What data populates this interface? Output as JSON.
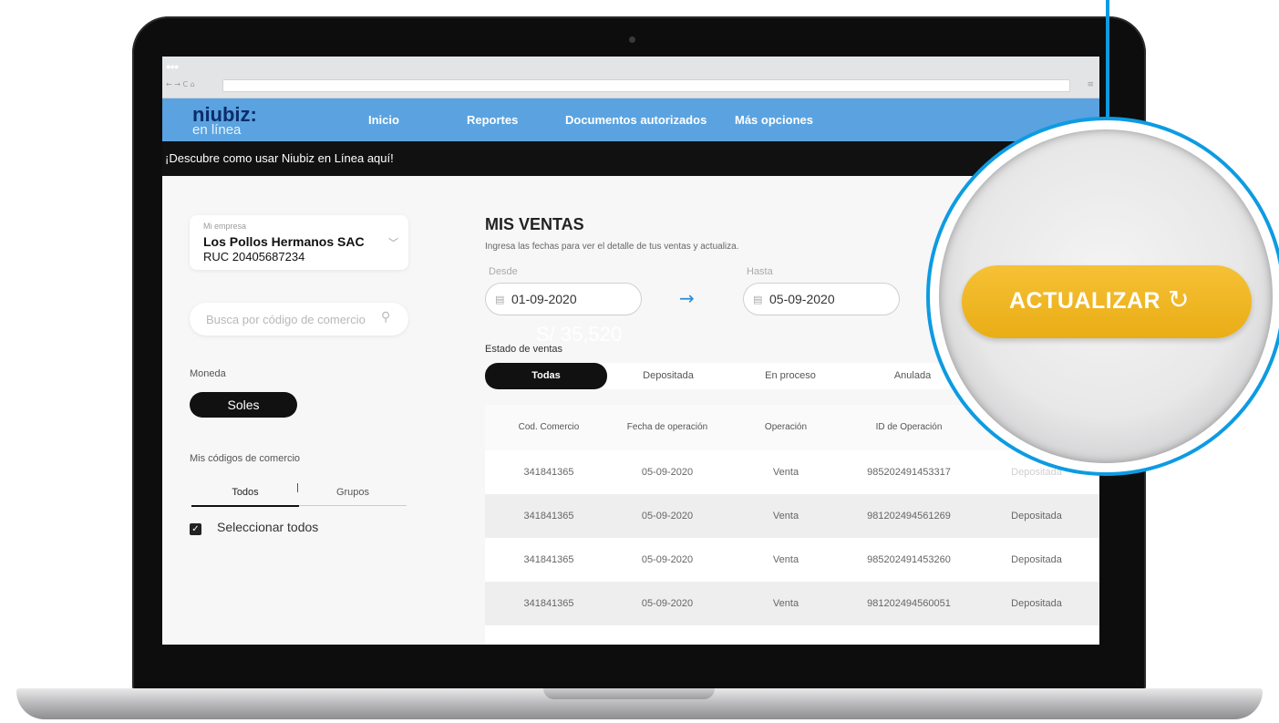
{
  "browser": {
    "dots": "●●●",
    "nav_icons": "← → C ⌂",
    "menu": "≡"
  },
  "app": {
    "logo_primary": "niubiz:",
    "logo_secondary": "en línea",
    "nav": [
      "Inicio",
      "Reportes",
      "Documentos autorizados",
      "Más opciones"
    ],
    "banner": "¡Descubre como usar Niubiz en Línea aquí!"
  },
  "sidebar": {
    "company_label": "Mi empresa",
    "company_name": "Los Pollos Hermanos SAC",
    "company_ruc": "RUC 20405687234",
    "search_placeholder": "Busca por código de comercio",
    "currency_label": "Moneda",
    "currency_selected": "Soles",
    "codes_label": "Mis códigos de comercio",
    "tabs": [
      "Todos",
      "Grupos"
    ],
    "select_all": "Seleccionar todos"
  },
  "main": {
    "title": "MIS VENTAS",
    "subtitle": "Ingresa las fechas para ver el detalle de tus ventas y actualiza.",
    "from_label": "Desde",
    "to_label": "Hasta",
    "from_value": "01-09-2020",
    "to_value": "05-09-2020",
    "amount_ghost": "S/ 35,520",
    "status_label": "Estado de ventas",
    "status_tabs": [
      "Todas",
      "Depositada",
      "En proceso",
      "Anulada"
    ],
    "table": {
      "headers": [
        "Cod. Comercio",
        "Fecha de operación",
        "Operación",
        "ID de Operación"
      ],
      "rows": [
        [
          "341841365",
          "05-09-2020",
          "Venta",
          "985202491453317",
          "Depositada"
        ],
        [
          "341841365",
          "05-09-2020",
          "Venta",
          "981202494561269",
          "Depositada"
        ],
        [
          "341841365",
          "05-09-2020",
          "Venta",
          "985202491453260",
          "Depositada"
        ],
        [
          "341841365",
          "05-09-2020",
          "Venta",
          "981202494560051",
          "Depositada"
        ]
      ]
    }
  },
  "zoom": {
    "button_label": "ACTUALIZAR",
    "button_icon": "↻"
  },
  "colors": {
    "brand_blue": "#5aa3e0",
    "accent_yellow": "#f2b827",
    "ring_blue": "#0d9be2"
  }
}
